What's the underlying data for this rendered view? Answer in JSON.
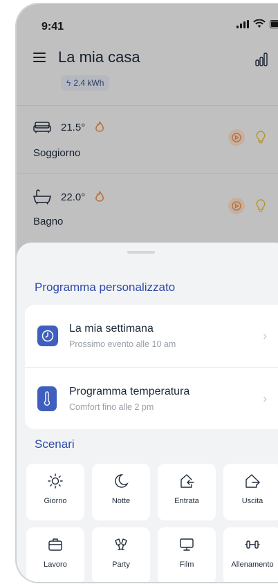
{
  "status_bar": {
    "time": "9:41"
  },
  "header": {
    "title": "La mia casa",
    "energy": "2.4 kWh"
  },
  "rooms": [
    {
      "temperature": "21.5°",
      "name": "Soggiorno",
      "icon": "sofa-icon"
    },
    {
      "temperature": "22.0°",
      "name": "Bagno",
      "icon": "bathtub-icon"
    }
  ],
  "sheet": {
    "custom_program_title": "Programma personalizzato",
    "programs": [
      {
        "title": "La mia settimana",
        "subtitle": "Prossimo evento alle 10 am",
        "icon": "clock-icon"
      },
      {
        "title": "Programma temperatura",
        "subtitle": "Comfort fino alle 2 pm",
        "icon": "thermometer-icon"
      }
    ],
    "scenarios_title": "Scenari",
    "scenarios": [
      {
        "label": "Giorno",
        "icon": "sun-icon"
      },
      {
        "label": "Notte",
        "icon": "moon-icon"
      },
      {
        "label": "Entrata",
        "icon": "enter-home-icon"
      },
      {
        "label": "Uscita",
        "icon": "exit-home-icon"
      },
      {
        "label": "Lavoro",
        "icon": "briefcase-icon"
      },
      {
        "label": "Party",
        "icon": "cheers-icon"
      },
      {
        "label": "Film",
        "icon": "monitor-icon"
      },
      {
        "label": "Allenamento",
        "icon": "dumbbell-icon"
      }
    ]
  },
  "colors": {
    "accent": "#3f5fbf",
    "section_title": "#2d4aa6",
    "flame": "#f08a3c",
    "sheet_bg": "#f2f3f5"
  }
}
